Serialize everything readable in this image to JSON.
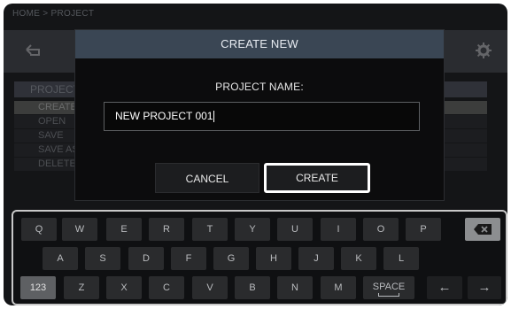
{
  "breadcrumb": "HOME > PROJECT",
  "menu": {
    "header": "PROJECT",
    "items": [
      "CREATE",
      "OPEN",
      "SAVE",
      "SAVE AS",
      "DELETE"
    ]
  },
  "dialog": {
    "title": "CREATE NEW",
    "field_label": "PROJECT NAME:",
    "input_value": "NEW PROJECT 001",
    "cancel_label": "CANCEL",
    "create_label": "CREATE"
  },
  "keyboard": {
    "row1": [
      "Q",
      "W",
      "E",
      "R",
      "T",
      "Y",
      "U",
      "I",
      "O",
      "P"
    ],
    "row2": [
      "A",
      "S",
      "D",
      "F",
      "G",
      "H",
      "J",
      "K",
      "L"
    ],
    "row3": [
      "Z",
      "X",
      "C",
      "V",
      "B",
      "N",
      "M"
    ],
    "mode_label": "123",
    "space_label": "SPACE",
    "left_arrow": "←",
    "right_arrow": "→",
    "backspace_icon": "backspace-icon"
  },
  "colors": {
    "dialog_title_bar": "#3a4654",
    "background": "#141517",
    "key": "#2a2b2d"
  }
}
